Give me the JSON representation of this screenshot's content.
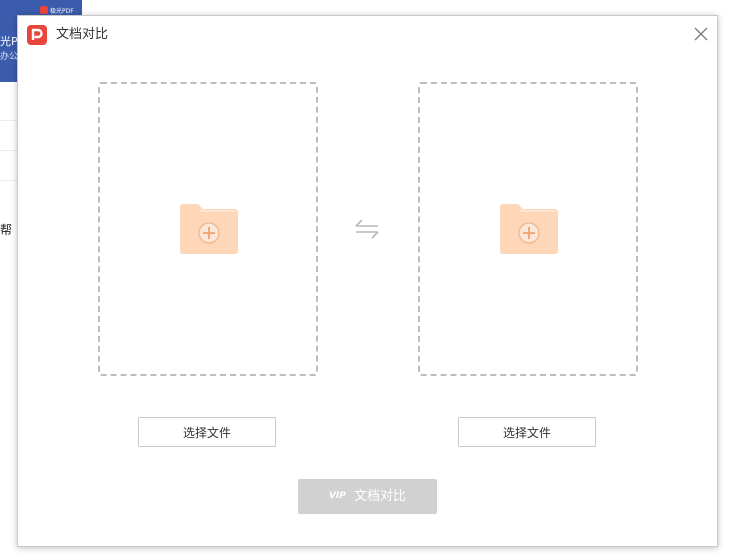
{
  "background_app": {
    "banner_mini_label": "极光PDF",
    "banner_line1": "光PD",
    "banner_line2": "办公助",
    "side_text": "帮"
  },
  "dialog": {
    "title": "文档对比",
    "left_panel": {
      "select_button_label": "选择文件"
    },
    "right_panel": {
      "select_button_label": "选择文件"
    },
    "compare_button": {
      "vip_badge": "VIP",
      "label": "文档对比",
      "enabled": false
    }
  },
  "icons": {
    "app_logo": "pdf-logo-icon",
    "close": "close-icon",
    "folder": "add-folder-icon",
    "swap": "swap-arrows-icon"
  },
  "colors": {
    "logo_red": "#e8453c",
    "folder_fill": "#fdd7b8",
    "compare_button_disabled": "#d1d1d1",
    "dashed_border": "#bdbdbd"
  }
}
